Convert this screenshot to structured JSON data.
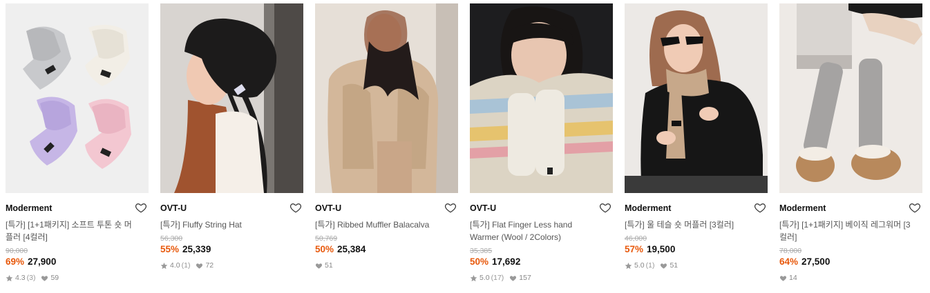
{
  "products": [
    {
      "brand": "Moderment",
      "title": "[특가] [1+1패키지] 소프트 투톤 숏 머플러 [4컬러]",
      "original_price": "90,000",
      "discount": "69%",
      "price": "27,900",
      "rating": "4.3",
      "reviews": "(3)",
      "likes": "59",
      "image": "four-pastel-scarves"
    },
    {
      "brand": "OVT-U",
      "title": "[특가] Fluffy String Hat",
      "original_price": "56,300",
      "discount": "55%",
      "price": "25,339",
      "rating": "4.0",
      "reviews": "(1)",
      "likes": "72",
      "image": "woman-black-fluffy-hat"
    },
    {
      "brand": "OVT-U",
      "title": "[특가] Ribbed Muffler Balacalva",
      "original_price": "50,769",
      "discount": "50%",
      "price": "25,384",
      "likes": "51",
      "image": "woman-black-balaclava"
    },
    {
      "brand": "OVT-U",
      "title": "[특가] Flat Finger Less hand Warmer (Wool / 2Colors)",
      "original_price": "35,385",
      "discount": "50%",
      "price": "17,692",
      "rating": "5.0",
      "reviews": "(17)",
      "likes": "157",
      "image": "woman-hand-warmers"
    },
    {
      "brand": "Moderment",
      "title": "[특가] 울 테슬 숏 머플러 [3컬러]",
      "original_price": "46,000",
      "discount": "57%",
      "price": "19,500",
      "rating": "5.0",
      "reviews": "(1)",
      "likes": "51",
      "image": "woman-beige-muffler"
    },
    {
      "brand": "Moderment",
      "title": "[특가] [1+1패키지] 베이직 레그워머 [3컬러]",
      "original_price": "78,000",
      "discount": "64%",
      "price": "27,500",
      "likes": "14",
      "image": "grey-leg-warmers"
    }
  ],
  "colors": {
    "discount": "#e8590c",
    "brand_text": "#111111",
    "title_text": "#555555",
    "meta_text": "#888888"
  }
}
